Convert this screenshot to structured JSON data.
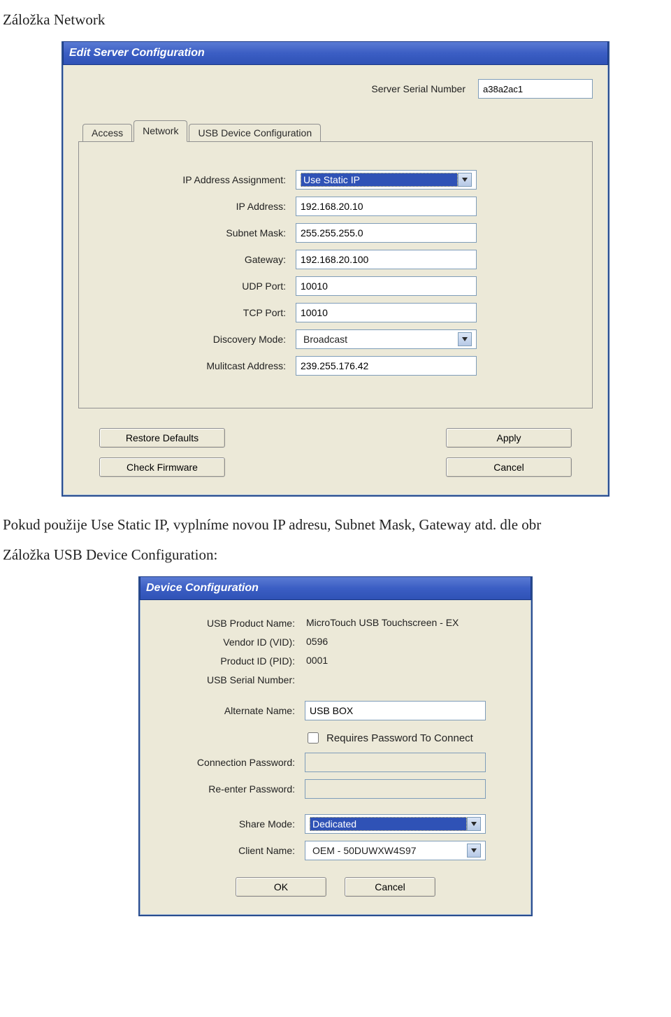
{
  "page": {
    "heading1": "Záložka Network",
    "body1": "Pokud použije Use Static IP, vyplníme novou IP adresu, Subnet Mask, Gateway  atd.  dle obr",
    "heading2": "Záložka USB Device Configuration:"
  },
  "dialog1": {
    "title": "Edit Server Configuration",
    "serial_label": "Server Serial Number",
    "serial_value": "a38a2ac1",
    "tabs": {
      "t0": "Access",
      "t1": "Network",
      "t2": "USB Device Configuration"
    },
    "fields": {
      "ip_assign_label": "IP Address Assignment:",
      "ip_assign_value": "Use Static IP",
      "ip_addr_label": "IP Address:",
      "ip_addr_value": "192.168.20.10",
      "subnet_label": "Subnet Mask:",
      "subnet_value": "255.255.255.0",
      "gateway_label": "Gateway:",
      "gateway_value": "192.168.20.100",
      "udp_label": "UDP Port:",
      "udp_value": "10010",
      "tcp_label": "TCP Port:",
      "tcp_value": "10010",
      "disc_label": "Discovery Mode:",
      "disc_value": "Broadcast",
      "mcast_label": "Mulitcast Address:",
      "mcast_value": "239.255.176.42"
    },
    "buttons": {
      "restore": "Restore Defaults",
      "check_fw": "Check Firmware",
      "apply": "Apply",
      "cancel": "Cancel"
    }
  },
  "dialog2": {
    "title": "Device Configuration",
    "fields": {
      "prod_name_label": "USB Product Name:",
      "prod_name_value": "MicroTouch USB Touchscreen - EX",
      "vid_label": "Vendor ID (VID):",
      "vid_value": "0596",
      "pid_label": "Product ID (PID):",
      "pid_value": "0001",
      "usb_sn_label": "USB Serial Number:",
      "usb_sn_value": "",
      "alt_name_label": "Alternate Name:",
      "alt_name_value": "USB BOX",
      "req_pw_label": "Requires Password To Connect",
      "conn_pw_label": "Connection Password:",
      "re_pw_label": "Re-enter Password:",
      "share_label": "Share Mode:",
      "share_value": "Dedicated",
      "client_label": "Client Name:",
      "client_value": "OEM - 50DUWXW4S97"
    },
    "buttons": {
      "ok": "OK",
      "cancel": "Cancel"
    }
  }
}
